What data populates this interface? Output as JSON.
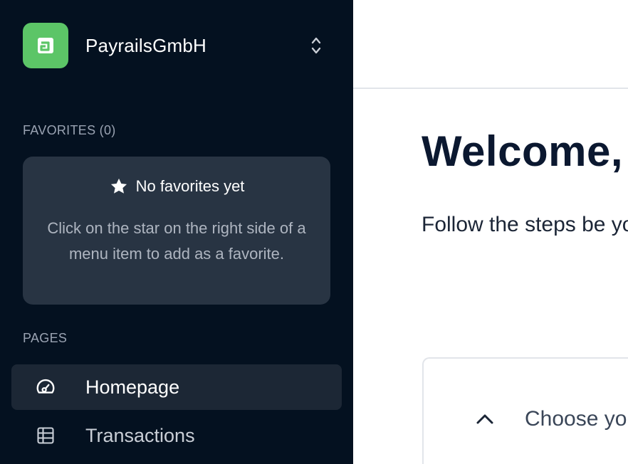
{
  "sidebar": {
    "org": {
      "logo_letter": "a",
      "name": "PayrailsGmbH"
    },
    "favorites": {
      "label": "FAVORITES (0)",
      "empty_title": "No favorites yet",
      "empty_desc": "Click on the star on the right side of a menu item to add as a favorite."
    },
    "pages": {
      "label": "PAGES",
      "items": [
        {
          "label": "Homepage",
          "icon": "dashboard-gauge-icon",
          "active": true
        },
        {
          "label": "Transactions",
          "icon": "table-icon",
          "active": false
        }
      ]
    }
  },
  "main": {
    "welcome": "Welcome,",
    "subtitle": "Follow the steps be you need.",
    "step": {
      "label": "Choose yo",
      "icon": "chevron-up-icon"
    }
  },
  "colors": {
    "sidebar_bg": "#041120",
    "logo_green": "#5cc567",
    "card_bg": "#283443",
    "active_bg": "#1c2735"
  }
}
